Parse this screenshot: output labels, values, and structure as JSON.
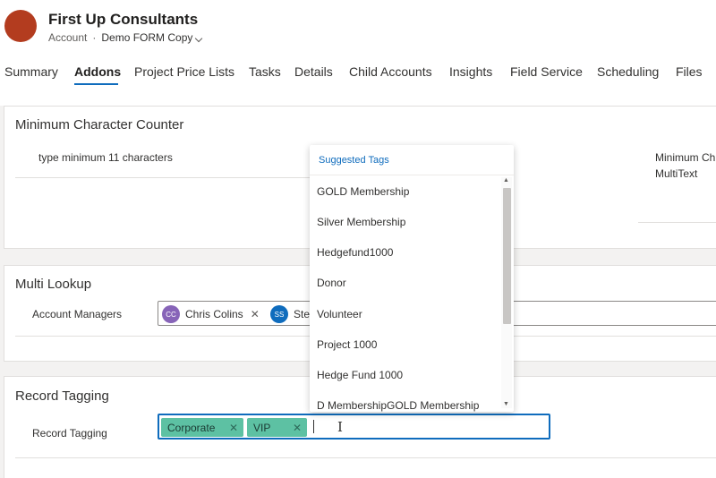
{
  "header": {
    "title": "First Up Consultants",
    "entity": "Account",
    "separator": "·",
    "form_name": "Demo FORM Copy"
  },
  "tabs": [
    {
      "label": "Summary"
    },
    {
      "label": "Addons"
    },
    {
      "label": "Project Price Lists"
    },
    {
      "label": "Tasks"
    },
    {
      "label": "Details"
    },
    {
      "label": "Child Accounts"
    },
    {
      "label": "Insights"
    },
    {
      "label": "Field Service"
    },
    {
      "label": "Scheduling"
    },
    {
      "label": "Files"
    }
  ],
  "active_tab": "Addons",
  "sections": {
    "min_char": {
      "title": "Minimum Character Counter",
      "field_label": "type minimum 11 characters",
      "right_label_1": "Minimum Ch",
      "right_label_2": "MultiText"
    },
    "multi_lookup": {
      "title": "Multi Lookup",
      "field_label": "Account Managers",
      "people": [
        {
          "initials": "CC",
          "name": "Chris Colins",
          "color": "#8764b8"
        },
        {
          "initials": "SS",
          "name": "Ste",
          "color": "#0f6cbd"
        }
      ],
      "remove_glyph": "✕"
    },
    "record_tagging": {
      "title": "Record Tagging",
      "field_label": "Record Tagging",
      "tags": [
        {
          "label": "Corporate",
          "remove": "✕"
        },
        {
          "label": "VIP",
          "remove": "✕"
        }
      ],
      "cursor_glyph": "I"
    }
  },
  "dropdown": {
    "header": "Suggested Tags",
    "items": [
      "GOLD Membership",
      "Silver Membership",
      "Hedgefund1000",
      "Donor",
      "Volunteer",
      "Project 1000",
      "Hedge Fund 1000",
      "D MembershipGOLD Membership"
    ],
    "scroll_up": "▲",
    "scroll_down": "▼"
  },
  "colors": {
    "accent": "#0f6cbd",
    "tag": "#5dc1a3",
    "avatar": "#b33c1f"
  }
}
